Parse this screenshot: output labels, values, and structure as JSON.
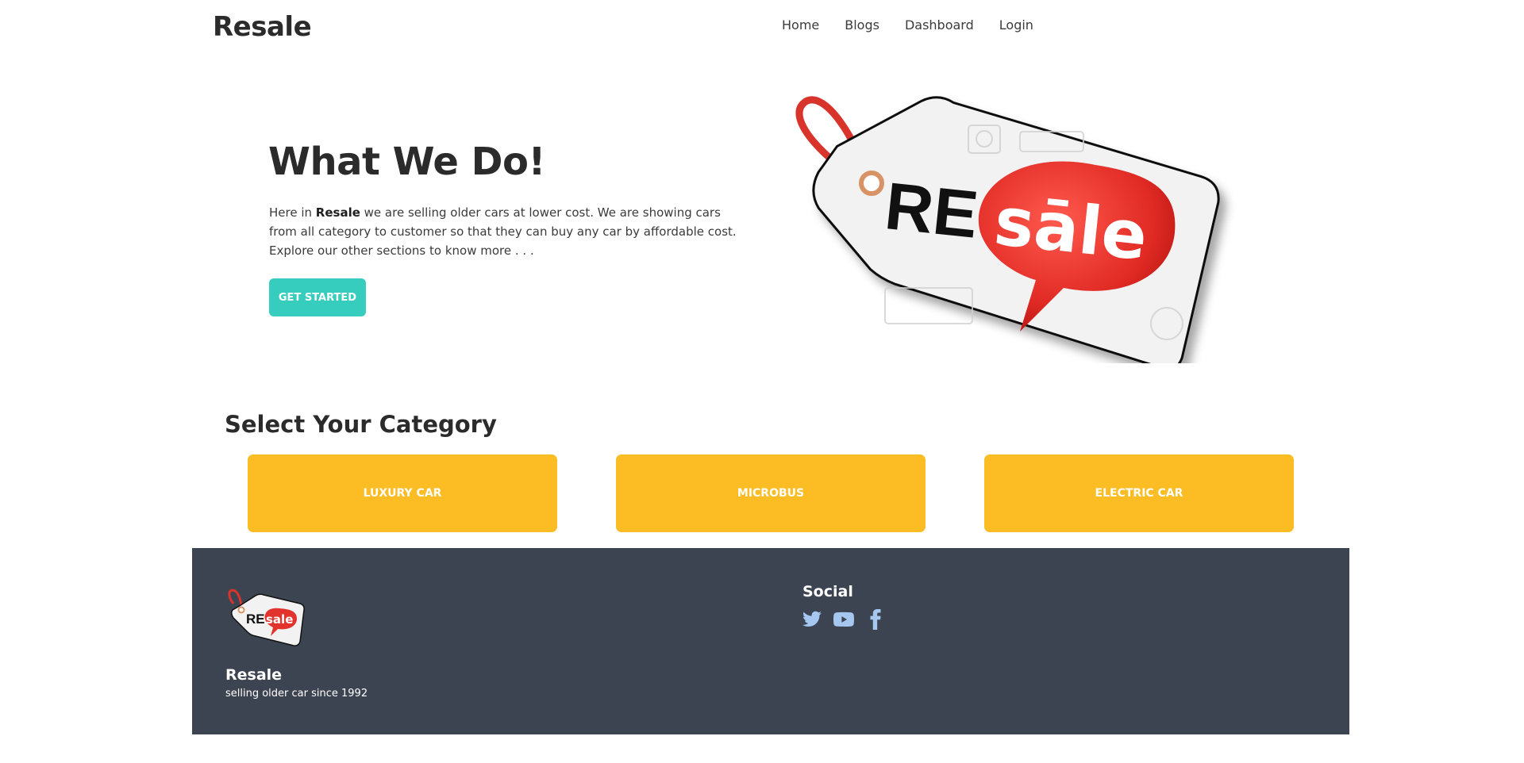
{
  "navbar": {
    "brand": "Resale",
    "links": [
      "Home",
      "Blogs",
      "Dashboard",
      "Login"
    ]
  },
  "hero": {
    "title": "What We Do!",
    "text_pre": "Here in ",
    "text_brand": "Resale",
    "text_post": " we are selling older cars at lower cost. We are showing cars from all category to customer so that they can buy any car by affordable cost. Explore our other sections to know more . . .",
    "button": "GET STARTED",
    "image_text_re": "RE",
    "image_text_sale": "sāle"
  },
  "categories": {
    "heading": "Select Your Category",
    "items": [
      "LUXURY CAR",
      "MICROBUS",
      "ELECTRIC CAR"
    ]
  },
  "footer": {
    "logo_text_re": "RE",
    "logo_text_sale": "sale",
    "brand": "Resale",
    "tagline": "selling older car since 1992",
    "social_title": "Social",
    "social_icons": [
      "twitter-icon",
      "youtube-icon",
      "facebook-icon"
    ]
  },
  "colors": {
    "accent_teal": "#37cdbe",
    "category_yellow": "#fbbd23",
    "footer_bg": "#3d4451",
    "social_icon": "#a6c8f0",
    "tag_red": "#e8322e"
  }
}
